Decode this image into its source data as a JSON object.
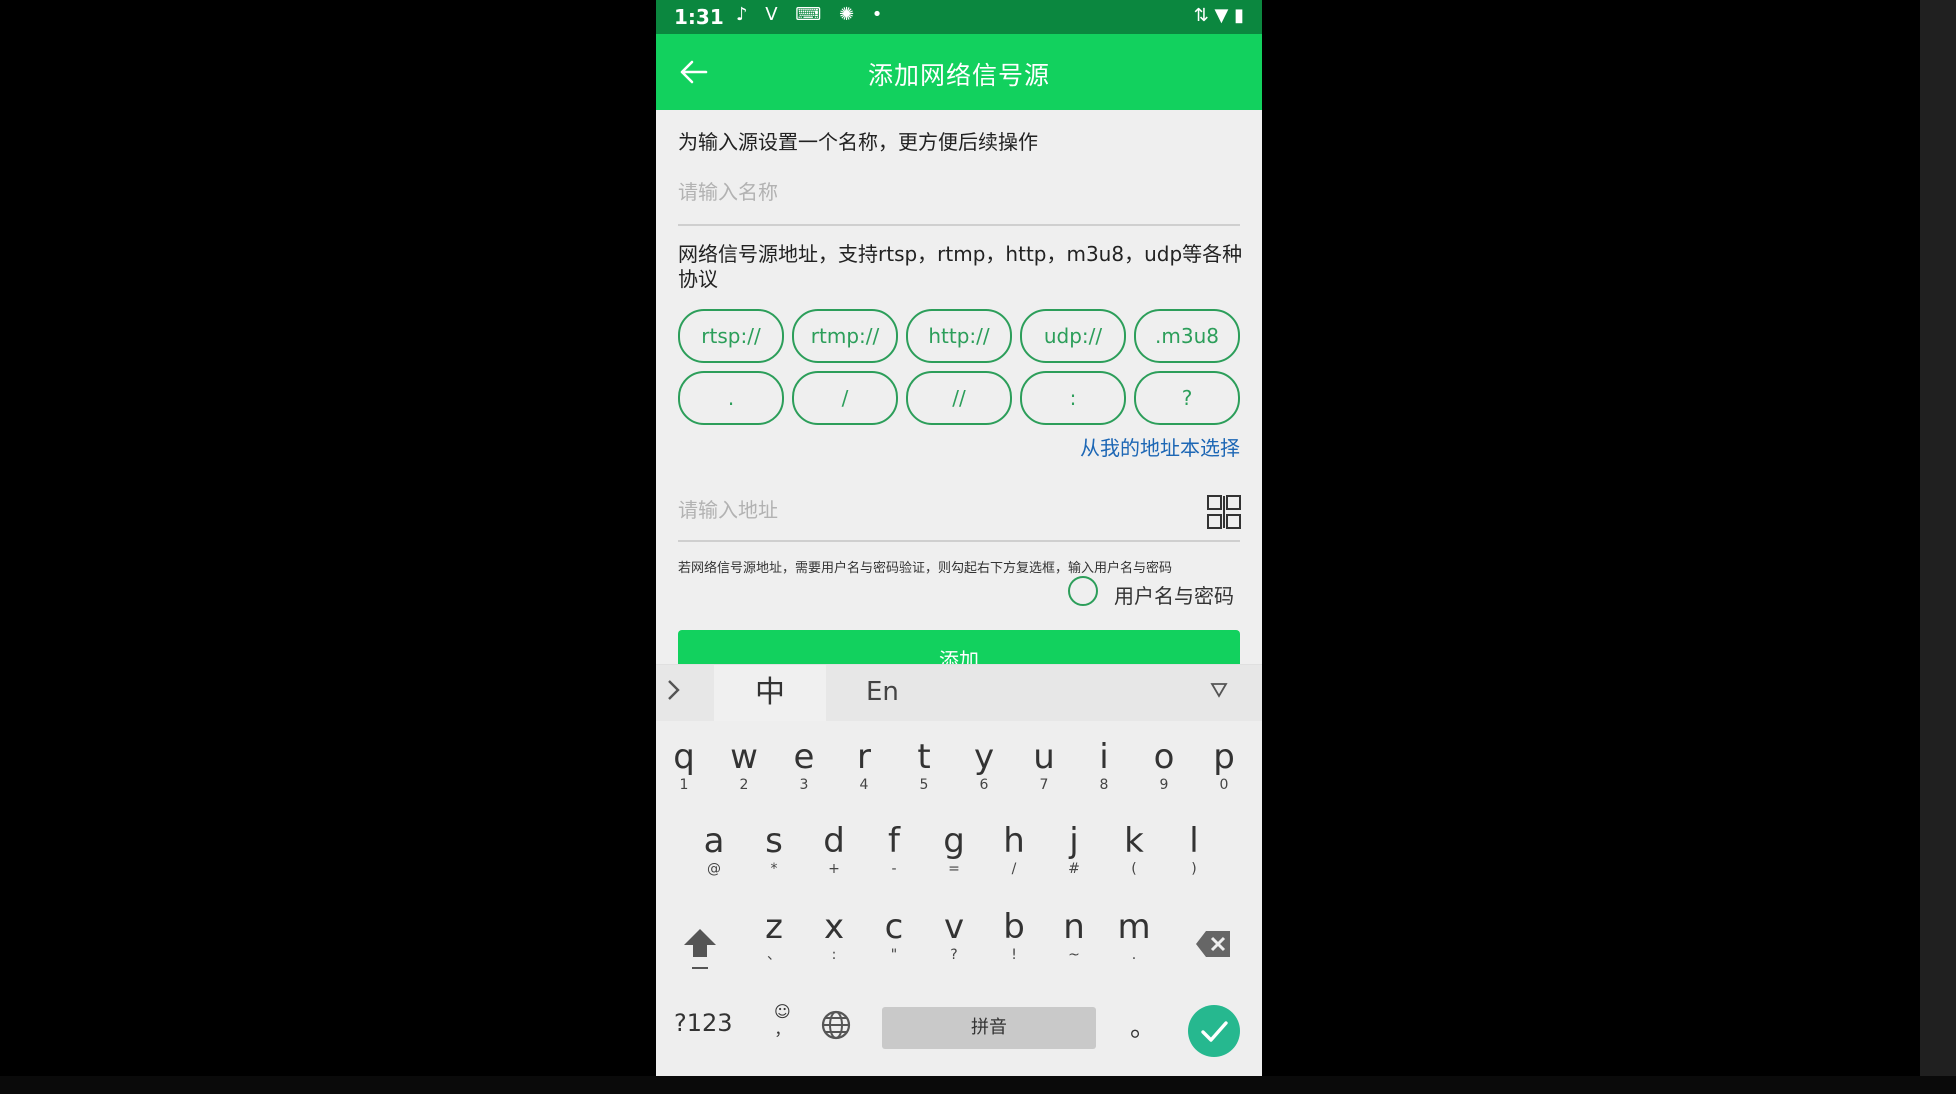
{
  "status_bar": {
    "time": "1:31",
    "left_icons": "♪ V ⌨ ✺ •",
    "right_icons": "⇅ ▼ ▮"
  },
  "appbar": {
    "title": "添加网络信号源",
    "back_icon": "arrow-left-icon"
  },
  "form": {
    "name_desc": "为输入源设置一个名称，更方便后续操作",
    "name_placeholder": "请输入名称",
    "addr_desc": "网络信号源地址，支持rtsp，rtmp，http，m3u8，udp等各种协议",
    "chips_row1": [
      "rtsp://",
      "rtmp://",
      "http://",
      "udp://",
      ".m3u8"
    ],
    "chips_row2": [
      ".",
      "/",
      "//",
      ":",
      "?"
    ],
    "addressbook_link": "从我的地址本选择",
    "addr_placeholder": "请输入地址",
    "auth_hint": "若网络信号源地址，需要用户名与密码验证，则勾起右下方复选框，输入用户名与密码",
    "auth_checkbox_label": "用户名与密码",
    "add_button": "添加"
  },
  "keyboard": {
    "toolbar": {
      "zh": "中",
      "en": "En"
    },
    "row1": [
      [
        "q",
        "1"
      ],
      [
        "w",
        "2"
      ],
      [
        "e",
        "3"
      ],
      [
        "r",
        "4"
      ],
      [
        "t",
        "5"
      ],
      [
        "y",
        "6"
      ],
      [
        "u",
        "7"
      ],
      [
        "i",
        "8"
      ],
      [
        "o",
        "9"
      ],
      [
        "p",
        "0"
      ]
    ],
    "row2": [
      [
        "a",
        "@"
      ],
      [
        "s",
        "*"
      ],
      [
        "d",
        "+"
      ],
      [
        "f",
        "-"
      ],
      [
        "g",
        "="
      ],
      [
        "h",
        "/"
      ],
      [
        "j",
        "#"
      ],
      [
        "k",
        "("
      ],
      [
        "l",
        ")"
      ]
    ],
    "row3": [
      [
        "z",
        "、"
      ],
      [
        "x",
        ":"
      ],
      [
        "c",
        "\""
      ],
      [
        "v",
        "?"
      ],
      [
        "b",
        "!"
      ],
      [
        "n",
        "~"
      ],
      [
        "m",
        "."
      ]
    ],
    "symbols_key": "?123",
    "comma_key": "，",
    "space_label": "拼音",
    "period_key": "。"
  },
  "colors": {
    "accent": "#12d15e",
    "status": "#0b873f",
    "chip": "#2c9e5a",
    "link": "#1d67b5",
    "enter": "#26b88f"
  }
}
